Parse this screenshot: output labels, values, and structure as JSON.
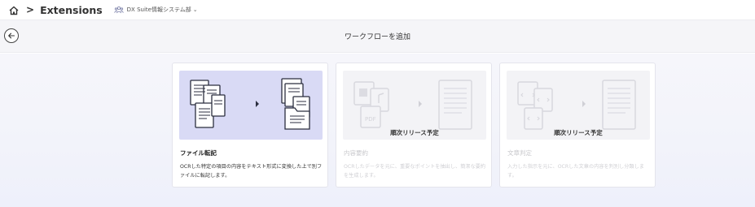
{
  "nav": {
    "separator": ">",
    "app_title": "Extensions",
    "org_name": "DX Suite情報システム部",
    "org_chevron": "⌄"
  },
  "header": {
    "title": "ワークフローを追加"
  },
  "cards": [
    {
      "title": "ファイル転記",
      "description": "OCRした特定の項目の内容をテキスト形式に変換した上で別ファイルに転記します。",
      "status": "",
      "enabled": true
    },
    {
      "title": "内容要約",
      "description": "OCRしたデータを元に、重要なポイントを抽出し、簡潔な要約を生成します。",
      "status": "順次リリース予定",
      "enabled": false
    },
    {
      "title": "文章判定",
      "description": "入力した指示を元に、OCRした文章の内容を判別し分類します。",
      "status": "順次リリース予定",
      "enabled": false
    }
  ],
  "colors": {
    "accent_illustration": "#d9daf5",
    "icon_dark": "#2b2e3f",
    "disabled_text": "#c8c8cc"
  }
}
